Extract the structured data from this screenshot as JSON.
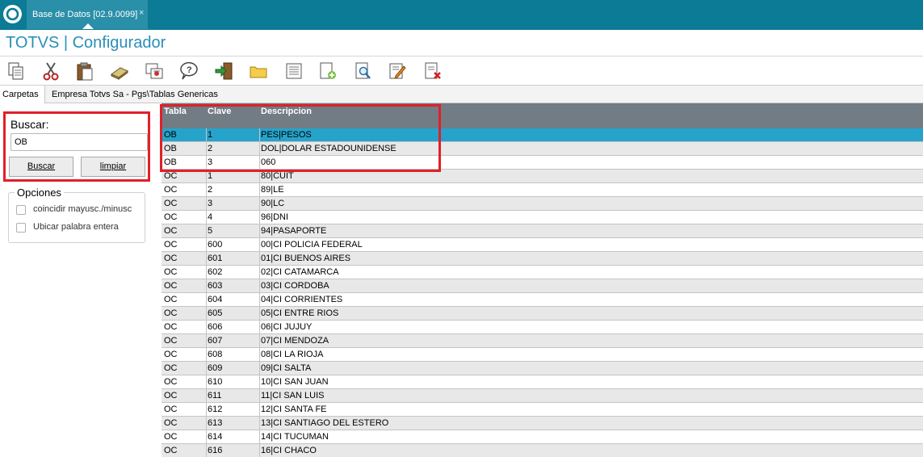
{
  "window": {
    "tab_label": "Base de Datos [02.9.0099]",
    "tab_close": "×",
    "app_title": "TOTVS | Configurador"
  },
  "toolbar": {
    "icons": [
      "copy-icon",
      "cut-icon",
      "paste-icon",
      "eraser-icon",
      "properties-icon",
      "help-icon",
      "exit-icon",
      "folder-icon",
      "list-icon",
      "add-icon",
      "preview-icon",
      "edit-icon",
      "delete-icon"
    ]
  },
  "tabs": {
    "carpetas": "Carpetas",
    "breadcrumb": "Empresa Totvs Sa - Pgs\\Tablas Genericas"
  },
  "search": {
    "label": "Buscar:",
    "value": "OB",
    "buscar_button": "Buscar",
    "limpiar_button": "limpiar"
  },
  "options": {
    "title": "Opciones",
    "match_case": "coincidir mayusc./minusc",
    "whole_word": "Ubicar palabra entera"
  },
  "grid": {
    "columns": [
      "Tabla",
      "Clave",
      "Descripcion"
    ],
    "rows": [
      [
        "OB",
        "1",
        "PES|PESOS"
      ],
      [
        "OB",
        "2",
        "DOL|DOLAR ESTADOUNIDENSE"
      ],
      [
        "OB",
        "3",
        "060"
      ],
      [
        "OC",
        "1",
        "80|CUIT"
      ],
      [
        "OC",
        "2",
        "89|LE"
      ],
      [
        "OC",
        "3",
        "90|LC"
      ],
      [
        "OC",
        "4",
        "96|DNI"
      ],
      [
        "OC",
        "5",
        "94|PASAPORTE"
      ],
      [
        "OC",
        "600",
        "00|CI POLICIA FEDERAL"
      ],
      [
        "OC",
        "601",
        "01|CI BUENOS AIRES"
      ],
      [
        "OC",
        "602",
        "02|CI CATAMARCA"
      ],
      [
        "OC",
        "603",
        "03|CI CORDOBA"
      ],
      [
        "OC",
        "604",
        "04|CI CORRIENTES"
      ],
      [
        "OC",
        "605",
        "05|CI ENTRE RIOS"
      ],
      [
        "OC",
        "606",
        "06|CI JUJUY"
      ],
      [
        "OC",
        "607",
        "07|CI MENDOZA"
      ],
      [
        "OC",
        "608",
        "08|CI LA RIOJA"
      ],
      [
        "OC",
        "609",
        "09|CI SALTA"
      ],
      [
        "OC",
        "610",
        "10|CI SAN JUAN"
      ],
      [
        "OC",
        "611",
        "11|CI SAN LUIS"
      ],
      [
        "OC",
        "612",
        "12|CI SANTA FE"
      ],
      [
        "OC",
        "613",
        "13|CI SANTIAGO DEL ESTERO"
      ],
      [
        "OC",
        "614",
        "14|CI TUCUMAN"
      ],
      [
        "OC",
        "616",
        "16|CI CHACO"
      ]
    ]
  },
  "colors": {
    "topbar": "#0b7b96",
    "accent": "#2a8fb8",
    "selected_row": "#26a3cb",
    "highlight_frame": "#e0202a",
    "grid_header": "#717c85"
  }
}
